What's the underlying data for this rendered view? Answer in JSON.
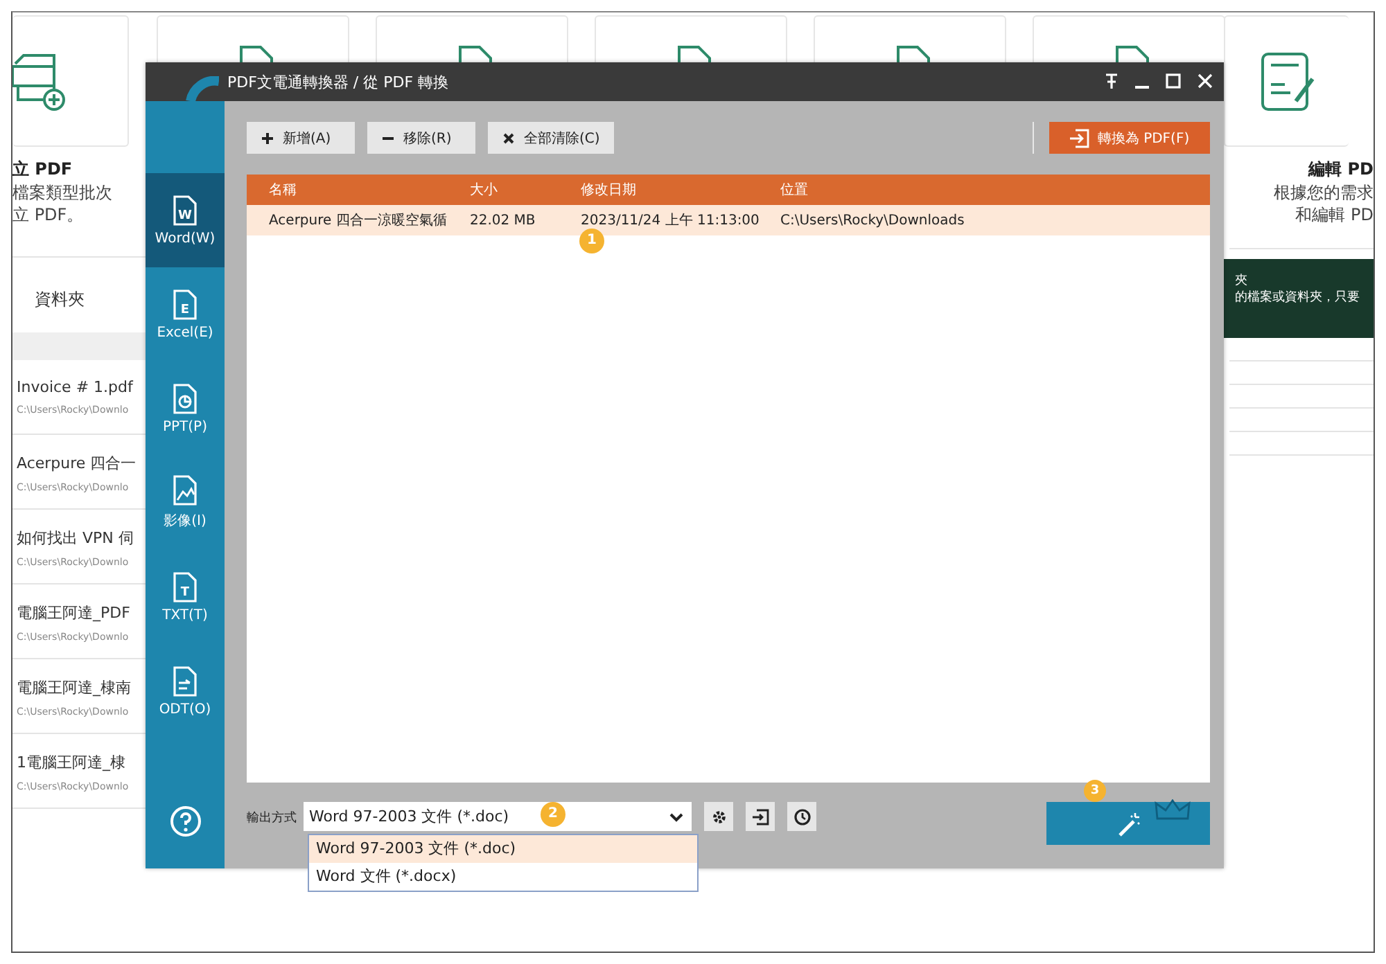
{
  "background_app": {
    "left_card": {
      "title": "立 PDF",
      "description": [
        "檔案類型批次",
        "立 PDF。"
      ]
    },
    "right_card": {
      "title": "編輯 PD",
      "description": [
        "根據您的需求",
        "和編輯 PD"
      ]
    },
    "folder_tab": "資料夾",
    "banner": {
      "lines": [
        "夾",
        "的檔案或資料夾，只要"
      ]
    },
    "recent_files": [
      {
        "name": "Invoice # 1.pdf",
        "path": "C:\\Users\\Rocky\\Downlo"
      },
      {
        "name": "Acerpure 四合一",
        "path": "C:\\Users\\Rocky\\Downlo"
      },
      {
        "name": "如何找出 VPN 伺",
        "path": "C:\\Users\\Rocky\\Downlo"
      },
      {
        "name": "電腦王阿達_PDF",
        "path": "C:\\Users\\Rocky\\Downlo"
      },
      {
        "name": "電腦王阿達_棣南",
        "path": "C:\\Users\\Rocky\\Downlo"
      },
      {
        "name": "1電腦王阿達_棣",
        "path": "C:\\Users\\Rocky\\Downlo"
      }
    ]
  },
  "dialog": {
    "title": "PDF文電通轉換器 / 從 PDF 轉換",
    "sidebar": [
      {
        "label": "Word(W)",
        "kind": "letter",
        "glyph": "W",
        "selected": true
      },
      {
        "label": "Excel(E)",
        "kind": "letter",
        "glyph": "E",
        "selected": false
      },
      {
        "label": "PPT(P)",
        "kind": "chart",
        "selected": false
      },
      {
        "label": "影像(I)",
        "kind": "image",
        "selected": false
      },
      {
        "label": "TXT(T)",
        "kind": "letter",
        "glyph": "T",
        "selected": false
      },
      {
        "label": "ODT(O)",
        "kind": "odt",
        "selected": false
      }
    ],
    "toolbar": [
      {
        "label": "新增(A)",
        "kind": "add"
      },
      {
        "label": "移除(R)",
        "kind": "remove"
      },
      {
        "label": "全部清除(C)",
        "kind": "clear"
      }
    ],
    "convert_button": "轉換為 PDF(F)",
    "table": {
      "columns": [
        "名稱",
        "大小",
        "修改日期",
        "位置"
      ],
      "rows": [
        {
          "cells": [
            "Acerpure 四合一涼暖空氣循",
            "22.02 MB",
            "2023/11/24 上午 11:13:00",
            "C:\\Users\\Rocky\\Downloads"
          ],
          "selected": true
        }
      ]
    },
    "output": {
      "label": "輸出方式",
      "value": "Word 97-2003 文件 (*.doc)",
      "options": [
        {
          "label": "Word 97-2003 文件 (*.doc)",
          "selected": true
        },
        {
          "label": "Word 文件 (*.docx)",
          "selected": false
        }
      ]
    },
    "annotations": [
      "1",
      "2",
      "3"
    ]
  }
}
